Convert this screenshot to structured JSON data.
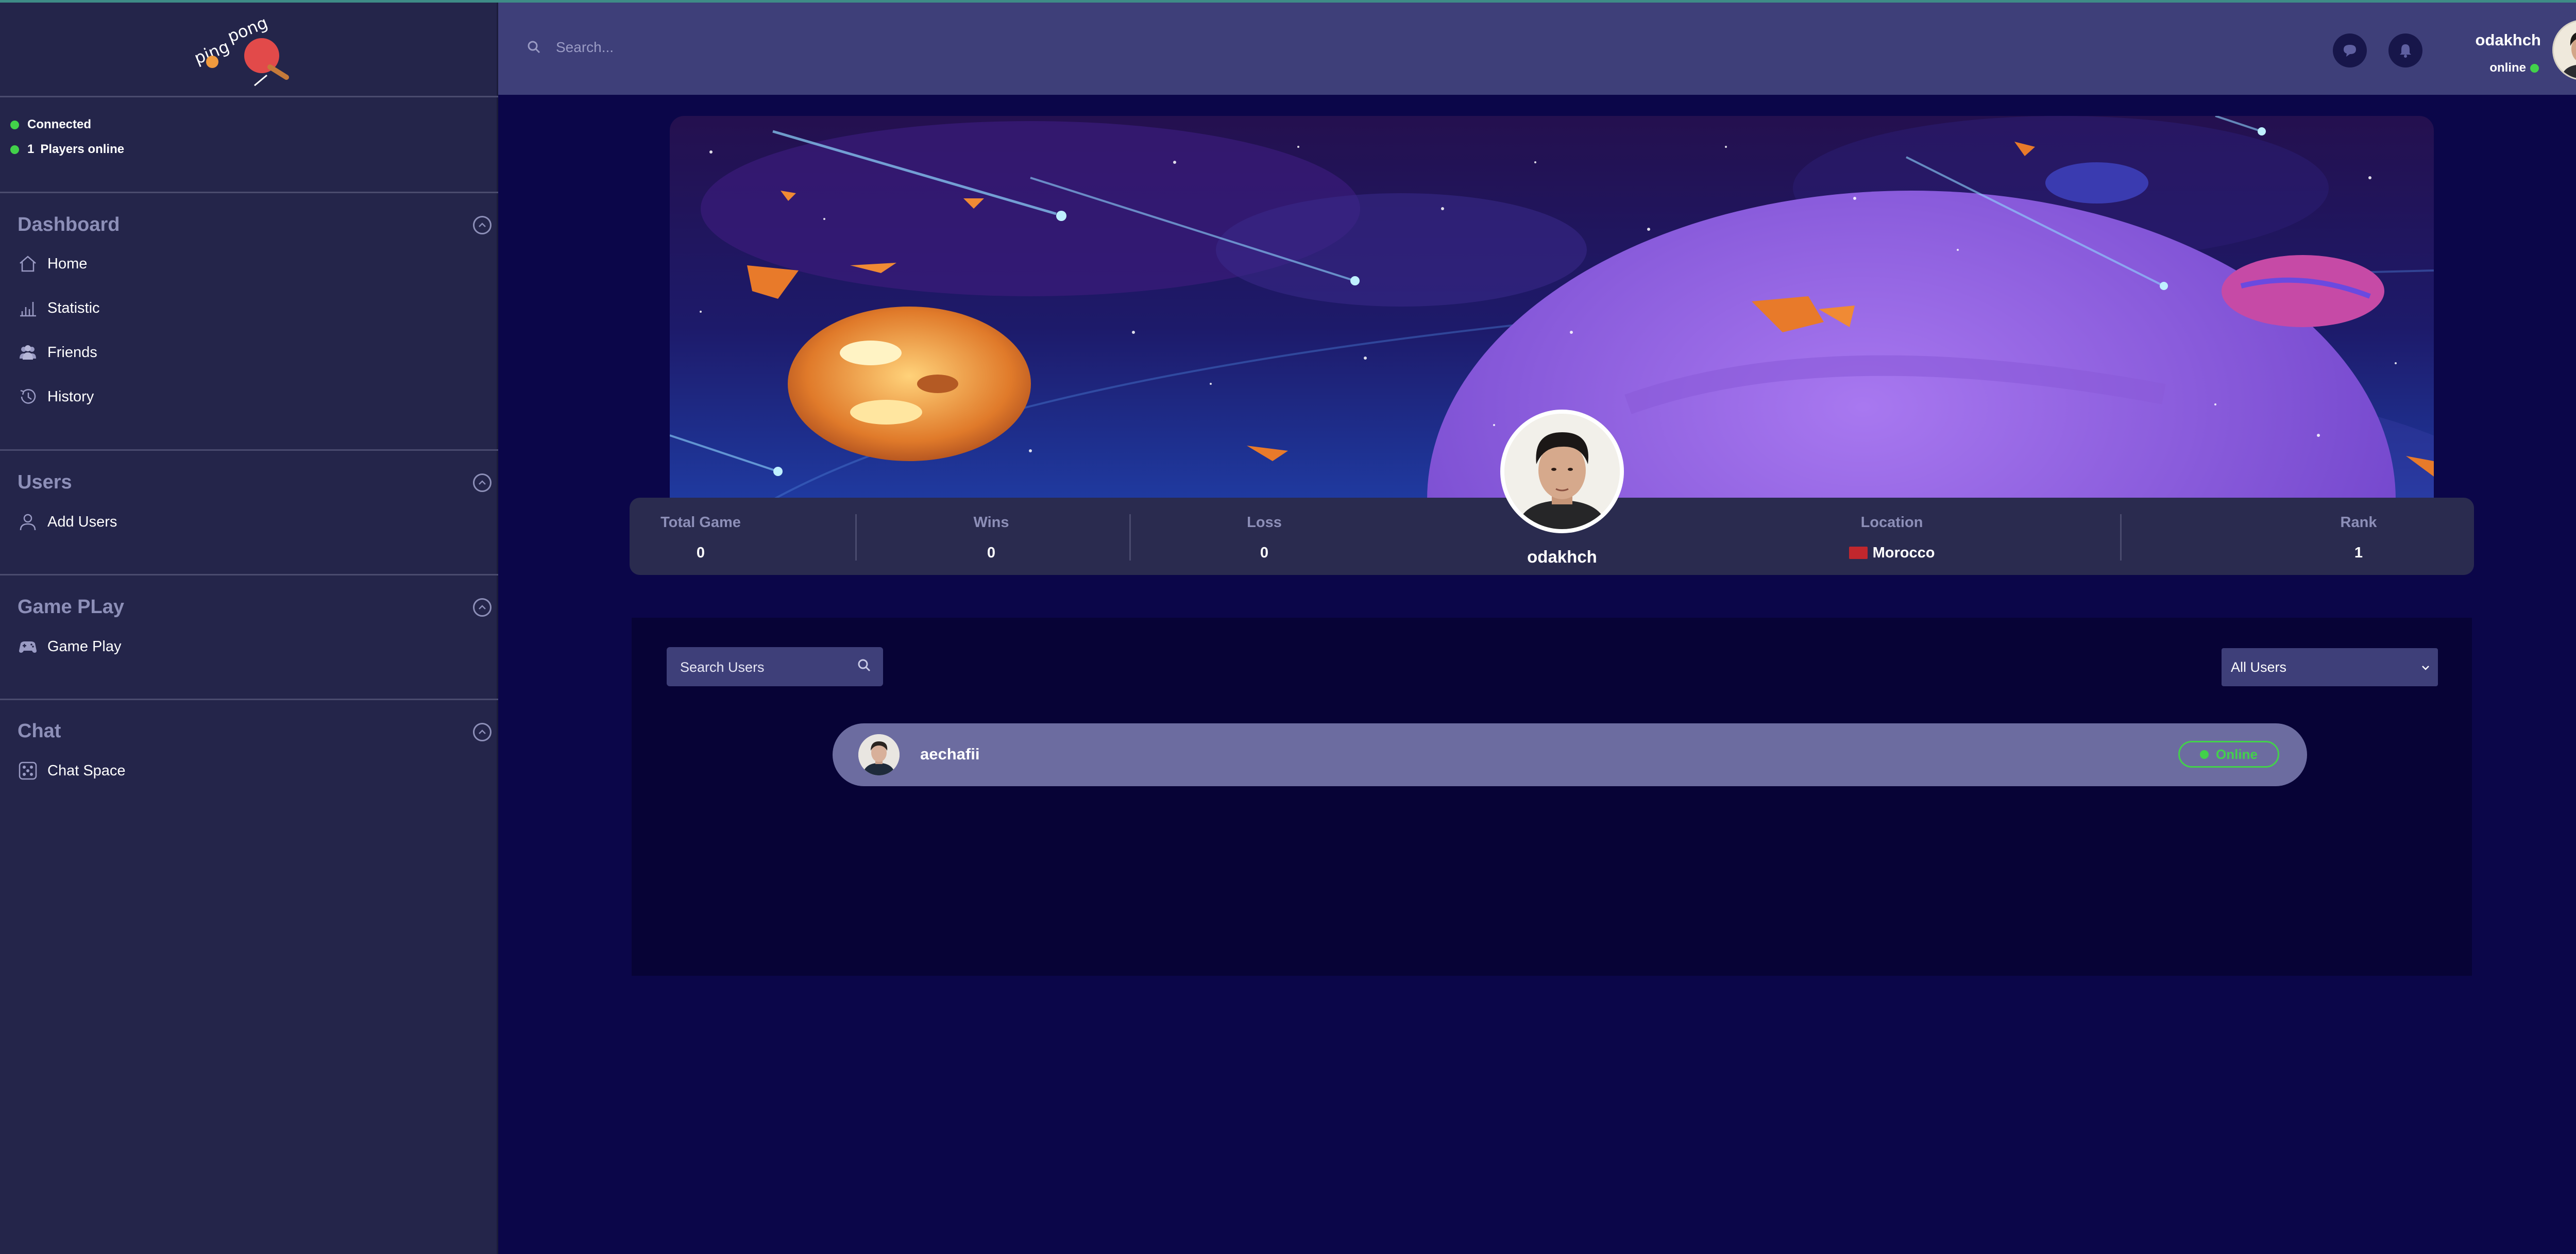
{
  "app": {
    "logo_text": "ping pong"
  },
  "connection": {
    "status": "Connected",
    "players_count": "1",
    "players_label": "Players online"
  },
  "sidebar": {
    "sections": [
      {
        "title": "Dashboard",
        "items": [
          {
            "label": "Home",
            "icon": "home-icon"
          },
          {
            "label": "Statistic",
            "icon": "chart-icon"
          },
          {
            "label": "Friends",
            "icon": "friends-icon"
          },
          {
            "label": "History",
            "icon": "history-icon"
          }
        ]
      },
      {
        "title": "Users",
        "items": [
          {
            "label": "Add Users",
            "icon": "user-icon"
          }
        ]
      },
      {
        "title": "Game PLay",
        "items": [
          {
            "label": "Game Play",
            "icon": "gamepad-icon"
          }
        ]
      },
      {
        "title": "Chat",
        "items": [
          {
            "label": "Chat Space",
            "icon": "chat-space-icon"
          }
        ]
      }
    ]
  },
  "header": {
    "search_placeholder": "Search...",
    "username": "odakhch",
    "status": "online"
  },
  "profile": {
    "username": "odakhch",
    "stats": {
      "total_game_label": "Total Game",
      "total_game": "0",
      "wins_label": "Wins",
      "wins": "0",
      "loss_label": "Loss",
      "loss": "0",
      "location_label": "Location",
      "location": "Morocco",
      "rank_label": "Rank",
      "rank": "1"
    }
  },
  "users_panel": {
    "search_placeholder": "Search Users",
    "filter_value": "All Users",
    "users": [
      {
        "name": "aechafii",
        "status": "Online"
      }
    ]
  },
  "colors": {
    "background": "#0b0649",
    "sidebar": "#24254a",
    "header": "#3e3f79",
    "online_green": "#43d14b",
    "flag_red": "#c1272d"
  }
}
